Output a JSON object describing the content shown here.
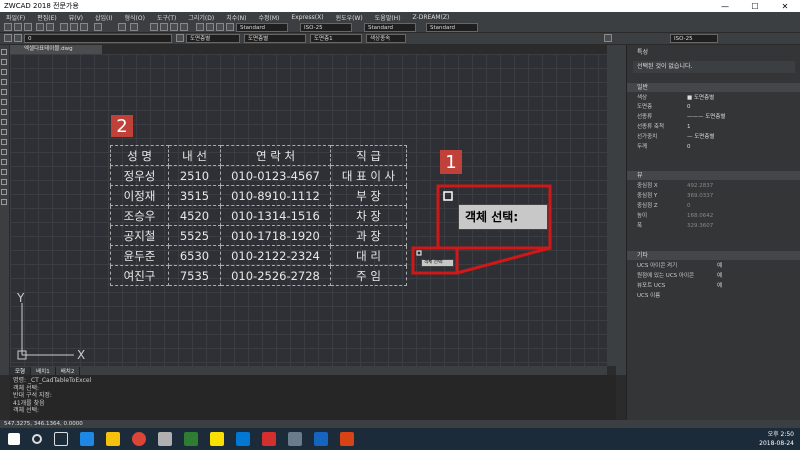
{
  "window": {
    "title": "ZWCAD 2018 전문가용",
    "buttons": [
      "—",
      "☐",
      "✕"
    ]
  },
  "menu": [
    "파일(F)",
    "편집(E)",
    "뷰(V)",
    "삽입(I)",
    "형식(O)",
    "도구(T)",
    "그리기(D)",
    "치수(N)",
    "수정(M)",
    "Express(X)",
    "윈도우(W)",
    "도움말(H)",
    "Z-DREAM(Z)"
  ],
  "toolbar": {
    "text_style": "Standard",
    "dim_style": "ISO-25",
    "table_style": "Standard",
    "multileader_style": "Standard",
    "layer": "0",
    "color": "도면층별",
    "linetype": "도면층별",
    "lineweight": "도면층1",
    "plot_style": "색상종속",
    "dim_style2": "ISO-25"
  },
  "drawing_tab": "엑셀다표테이블.dwg",
  "markers": {
    "one": "1",
    "two": "2"
  },
  "cad_table": {
    "headers": [
      "성 명",
      "내 선",
      "연 락 처",
      "직 급"
    ],
    "rows": [
      [
        "정우성",
        "2510",
        "010-0123-4567",
        "대 표 이 사"
      ],
      [
        "이정재",
        "3515",
        "010-8910-1112",
        "부 장"
      ],
      [
        "조승우",
        "4520",
        "010-1314-1516",
        "차 장"
      ],
      [
        "공지철",
        "5525",
        "010-1718-1920",
        "과 장"
      ],
      [
        "윤두준",
        "6530",
        "010-2122-2324",
        "대 리"
      ],
      [
        "여진구",
        "7535",
        "010-2526-2728",
        "주 임"
      ]
    ]
  },
  "callout": {
    "large_text": "객체 선택:",
    "small_text": "객체 선택:"
  },
  "ucs": {
    "x": "X",
    "y": "Y"
  },
  "layout_tabs": [
    "모형",
    "배치1",
    "배치2"
  ],
  "command_lines": [
    "명령: _CT_CadTableToExcel",
    "객체 선택:",
    "반대 구석 지정:",
    "41개를 찾음",
    "객체 선택: "
  ],
  "statusbar": {
    "coords": "547.3275, 346.1364, 0.0000"
  },
  "properties": {
    "title": "특성",
    "no_selection": "선택된 것이 없습니다.",
    "general_header": "일반",
    "general": [
      {
        "k": "색상",
        "v": "■ 도면층별"
      },
      {
        "k": "도면층",
        "v": "0"
      },
      {
        "k": "선종류",
        "v": "——— 도면층별"
      },
      {
        "k": "선종류 축척",
        "v": "1"
      },
      {
        "k": "선가중치",
        "v": "— 도면층별"
      },
      {
        "k": "두께",
        "v": "0"
      }
    ],
    "view_header": "뷰",
    "view": [
      {
        "k": "중심점 X",
        "v": "492.2837"
      },
      {
        "k": "중심점 Y",
        "v": "369.0337"
      },
      {
        "k": "중심점 Z",
        "v": "0"
      },
      {
        "k": "높이",
        "v": "168.0642"
      },
      {
        "k": "폭",
        "v": "329.3607"
      }
    ],
    "misc_header": "기타",
    "misc": [
      {
        "k": "UCS 아이콘 켜기",
        "v": "예"
      },
      {
        "k": "원점에 있는 UCS 아이콘",
        "v": "예"
      },
      {
        "k": "뷰포트 UCS",
        "v": "예"
      },
      {
        "k": "UCS 이름",
        "v": ""
      }
    ]
  },
  "tray": {
    "time": "오후 2:50",
    "date": "2018-08-24"
  },
  "colors": {
    "marker": "#c0403a",
    "callout": "#d01818",
    "canvas": "#2e3035"
  }
}
